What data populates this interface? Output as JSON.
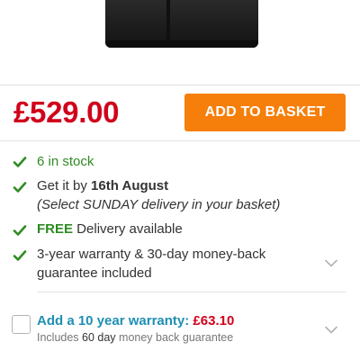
{
  "product": {
    "image_alt": "black product"
  },
  "price": "£529.00",
  "basket_button": "ADD TO BASKET",
  "features": {
    "stock": "6 in stock",
    "delivery_prefix": "Get it by ",
    "delivery_date": "16th August",
    "delivery_note": "(Select SUNDAY delivery in your basket)",
    "free_word": "FREE",
    "free_rest": " Delivery available",
    "warranty_line1": "3-year warranty & 30-day money-back",
    "warranty_line2": "guarantee included"
  },
  "addon": {
    "title": "Add a 10 year warranty: ",
    "price": "£63.10",
    "sub_prefix": "Includes ",
    "sub_strong": "60 day",
    "sub_rest": " money back guarantee"
  },
  "icons": {
    "check": "check-icon",
    "chevron": "chevron-down-icon"
  },
  "colors": {
    "price": "#d0021b",
    "button": "#f57f0a",
    "check": "#2e8b22",
    "link": "#1f8fb3"
  }
}
